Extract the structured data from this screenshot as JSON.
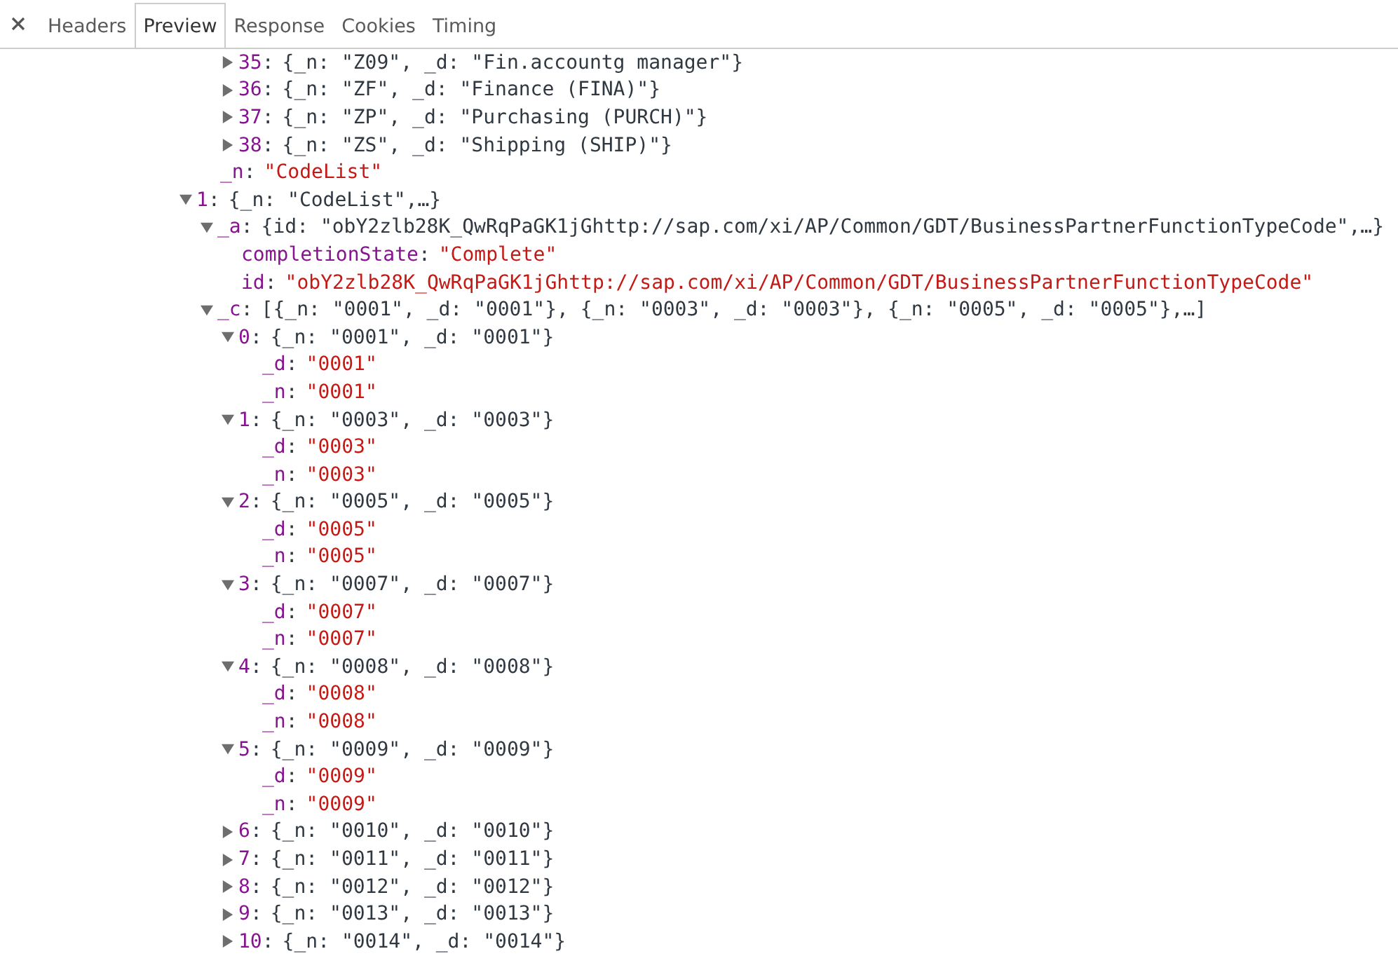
{
  "tabs": [
    {
      "label": "Headers",
      "selected": false
    },
    {
      "label": "Preview",
      "selected": true
    },
    {
      "label": "Response",
      "selected": false
    },
    {
      "label": "Cookies",
      "selected": false
    },
    {
      "label": "Timing",
      "selected": false
    }
  ],
  "separator": ":",
  "tree": [
    {
      "children": [
        {
          "children": [
            {
              "key": "35",
              "summary": "{_n: \"Z09\", _d: \"Fin.accountg manager\"}",
              "expanded": false
            },
            {
              "key": "36",
              "summary": "{_n: \"ZF\", _d: \"Finance (FINA)\"}",
              "expanded": false
            },
            {
              "key": "37",
              "summary": "{_n: \"ZP\", _d: \"Purchasing (PURCH)\"}",
              "expanded": false
            },
            {
              "key": "38",
              "summary": "{_n: \"ZS\", _d: \"Shipping (SHIP)\"}",
              "expanded": false
            }
          ]
        },
        {
          "key": "_n",
          "value": "\"CodeList\""
        }
      ]
    },
    {
      "key": "1",
      "summary": "{_n: \"CodeList\",…}",
      "expanded": true,
      "children": [
        {
          "key": "_a",
          "summary": "{id: \"obY2zlb28K_QwRqPaGK1jGhttp://sap.com/xi/AP/Common/GDT/BusinessPartnerFunctionTypeCode\",…}",
          "expanded": true,
          "children": [
            {
              "key": "completionState",
              "value": "\"Complete\""
            },
            {
              "key": "id",
              "value": "\"obY2zlb28K_QwRqPaGK1jGhttp://sap.com/xi/AP/Common/GDT/BusinessPartnerFunctionTypeCode\""
            }
          ]
        },
        {
          "key": "_c",
          "summary": "[{_n: \"0001\", _d: \"0001\"}, {_n: \"0003\", _d: \"0003\"}, {_n: \"0005\", _d: \"0005\"},…]",
          "expanded": true,
          "children": [
            {
              "key": "0",
              "summary": "{_n: \"0001\", _d: \"0001\"}",
              "expanded": true,
              "children": [
                {
                  "key": "_d",
                  "value": "\"0001\""
                },
                {
                  "key": "_n",
                  "value": "\"0001\""
                }
              ]
            },
            {
              "key": "1",
              "summary": "{_n: \"0003\", _d: \"0003\"}",
              "expanded": true,
              "children": [
                {
                  "key": "_d",
                  "value": "\"0003\""
                },
                {
                  "key": "_n",
                  "value": "\"0003\""
                }
              ]
            },
            {
              "key": "2",
              "summary": "{_n: \"0005\", _d: \"0005\"}",
              "expanded": true,
              "children": [
                {
                  "key": "_d",
                  "value": "\"0005\""
                },
                {
                  "key": "_n",
                  "value": "\"0005\""
                }
              ]
            },
            {
              "key": "3",
              "summary": "{_n: \"0007\", _d: \"0007\"}",
              "expanded": true,
              "children": [
                {
                  "key": "_d",
                  "value": "\"0007\""
                },
                {
                  "key": "_n",
                  "value": "\"0007\""
                }
              ]
            },
            {
              "key": "4",
              "summary": "{_n: \"0008\", _d: \"0008\"}",
              "expanded": true,
              "children": [
                {
                  "key": "_d",
                  "value": "\"0008\""
                },
                {
                  "key": "_n",
                  "value": "\"0008\""
                }
              ]
            },
            {
              "key": "5",
              "summary": "{_n: \"0009\", _d: \"0009\"}",
              "expanded": true,
              "children": [
                {
                  "key": "_d",
                  "value": "\"0009\""
                },
                {
                  "key": "_n",
                  "value": "\"0009\""
                }
              ]
            },
            {
              "key": "6",
              "summary": "{_n: \"0010\", _d: \"0010\"}",
              "expanded": false
            },
            {
              "key": "7",
              "summary": "{_n: \"0011\", _d: \"0011\"}",
              "expanded": false
            },
            {
              "key": "8",
              "summary": "{_n: \"0012\", _d: \"0012\"}",
              "expanded": false
            },
            {
              "key": "9",
              "summary": "{_n: \"0013\", _d: \"0013\"}",
              "expanded": false
            },
            {
              "key": "10",
              "summary": "{_n: \"0014\", _d: \"0014\"}",
              "expanded": false
            }
          ]
        }
      ]
    }
  ]
}
